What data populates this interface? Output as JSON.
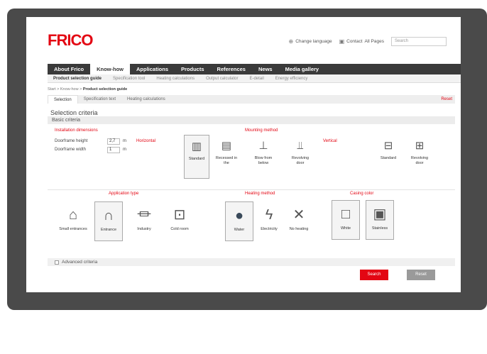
{
  "brand": {
    "logo": "FRICO",
    "accent": "#e30613",
    "frame_color": "#4a4a4a"
  },
  "utility": {
    "language": "Change language",
    "contact": "Contact",
    "pages": "All Pages",
    "search_placeholder": "Search"
  },
  "topnav": [
    "About Frico",
    "Know-how",
    "Applications",
    "Products",
    "References",
    "News",
    "Media gallery"
  ],
  "topnav_active": "Know-how",
  "subnav": [
    "Product selection guide",
    "Specification tool",
    "Heating calculations",
    "Output calculator",
    "E-detail",
    "Energy efficiency"
  ],
  "breadcrumb": {
    "path": "Start > Know-how > ",
    "current": "Product selection guide"
  },
  "tabs": [
    "Selection",
    "Specification text",
    "Heating calculations"
  ],
  "tabs_reset": "Reset",
  "section_title": "Selection criteria",
  "basic_criteria": "Basic criteria",
  "installation": {
    "heading": "Installation dimensions",
    "height_label": "Doorframe height",
    "height_value": "2,7",
    "width_label": "Doorframe width",
    "width_value": "1",
    "unit": "m",
    "orientation": "Horizontal"
  },
  "mounting": {
    "heading": "Mounting method",
    "horizontal": [
      "Standard",
      "Recessed in the",
      "Blow from below",
      "Revolving door"
    ],
    "vertical_heading": "Vertical",
    "vertical": [
      "Standard",
      "Revolving door"
    ]
  },
  "application": {
    "heading": "Application type",
    "items": [
      "Small entrances",
      "Entrance",
      "Industry",
      "Cold room"
    ]
  },
  "heating": {
    "heading": "Heating method",
    "items": [
      "Water",
      "Electricity",
      "No heating"
    ]
  },
  "casing": {
    "heading": "Casing color",
    "items": [
      "White",
      "Stainless"
    ]
  },
  "advanced": "Advanced criteria",
  "buttons": {
    "search": "Search",
    "reset": "Reset"
  }
}
